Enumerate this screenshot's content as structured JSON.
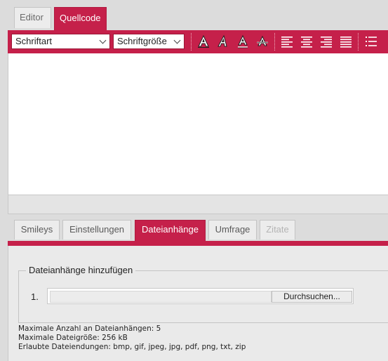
{
  "editor_tabs": [
    {
      "label": "Editor",
      "active": false
    },
    {
      "label": "Quellcode",
      "active": true
    }
  ],
  "toolbar": {
    "font_select": {
      "value": "Schriftart"
    },
    "size_select": {
      "value": "Schriftgröße"
    },
    "format_buttons": [
      "bold-icon",
      "italic-icon",
      "underline-icon",
      "strikethrough-icon"
    ],
    "align_buttons": [
      "align-left-icon",
      "align-center-icon",
      "align-right-icon",
      "align-justify-icon"
    ],
    "list_buttons": [
      "bulleted-list-icon"
    ]
  },
  "bottom_tabs": [
    {
      "label": "Smileys",
      "state": "normal"
    },
    {
      "label": "Einstellungen",
      "state": "normal"
    },
    {
      "label": "Dateianhänge",
      "state": "active"
    },
    {
      "label": "Umfrage",
      "state": "normal"
    },
    {
      "label": "Zitate",
      "state": "disabled"
    }
  ],
  "attachments": {
    "legend": "Dateianhänge hinzufügen",
    "row_number": "1.",
    "file_value": "",
    "browse_label": "Durchsuchen...",
    "info_lines": [
      "Maximale Anzahl an Dateianhängen: 5",
      "Maximale Dateigröße: 256 kB",
      "Erlaubte Dateiendungen: bmp, gif, jpeg, jpg, pdf, png, txt, zip"
    ]
  },
  "colors": {
    "accent": "#c5204a",
    "background": "#dcdcdc",
    "panel": "#eaeaea"
  }
}
